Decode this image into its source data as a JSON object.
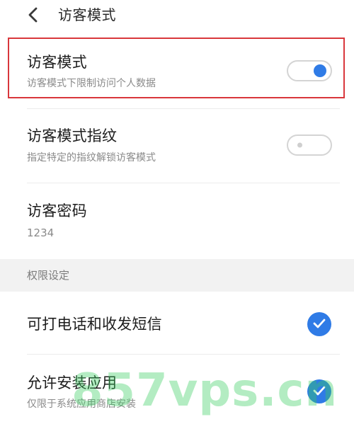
{
  "header": {
    "title": "访客模式",
    "back_icon": "chevron-left-icon"
  },
  "settings": [
    {
      "title": "访客模式",
      "subtitle": "访客模式下限制访问个人数据",
      "control": "toggle",
      "enabled": true
    },
    {
      "title": "访客模式指纹",
      "subtitle": "指定特定的指纹解锁访客模式",
      "control": "toggle",
      "enabled": false
    },
    {
      "title": "访客密码",
      "subtitle": "1234"
    }
  ],
  "permissions": {
    "section_title": "权限设定",
    "items": [
      {
        "title": "可打电话和收发短信",
        "checked": true
      },
      {
        "title": "允许安装应用",
        "subtitle": "仅限于系统应用商店安装",
        "checked": true
      }
    ]
  },
  "watermark": "857vps.cn",
  "colors": {
    "accent": "#2f7be6",
    "highlight": "#d9373c",
    "watermark": "#36ce5f"
  }
}
